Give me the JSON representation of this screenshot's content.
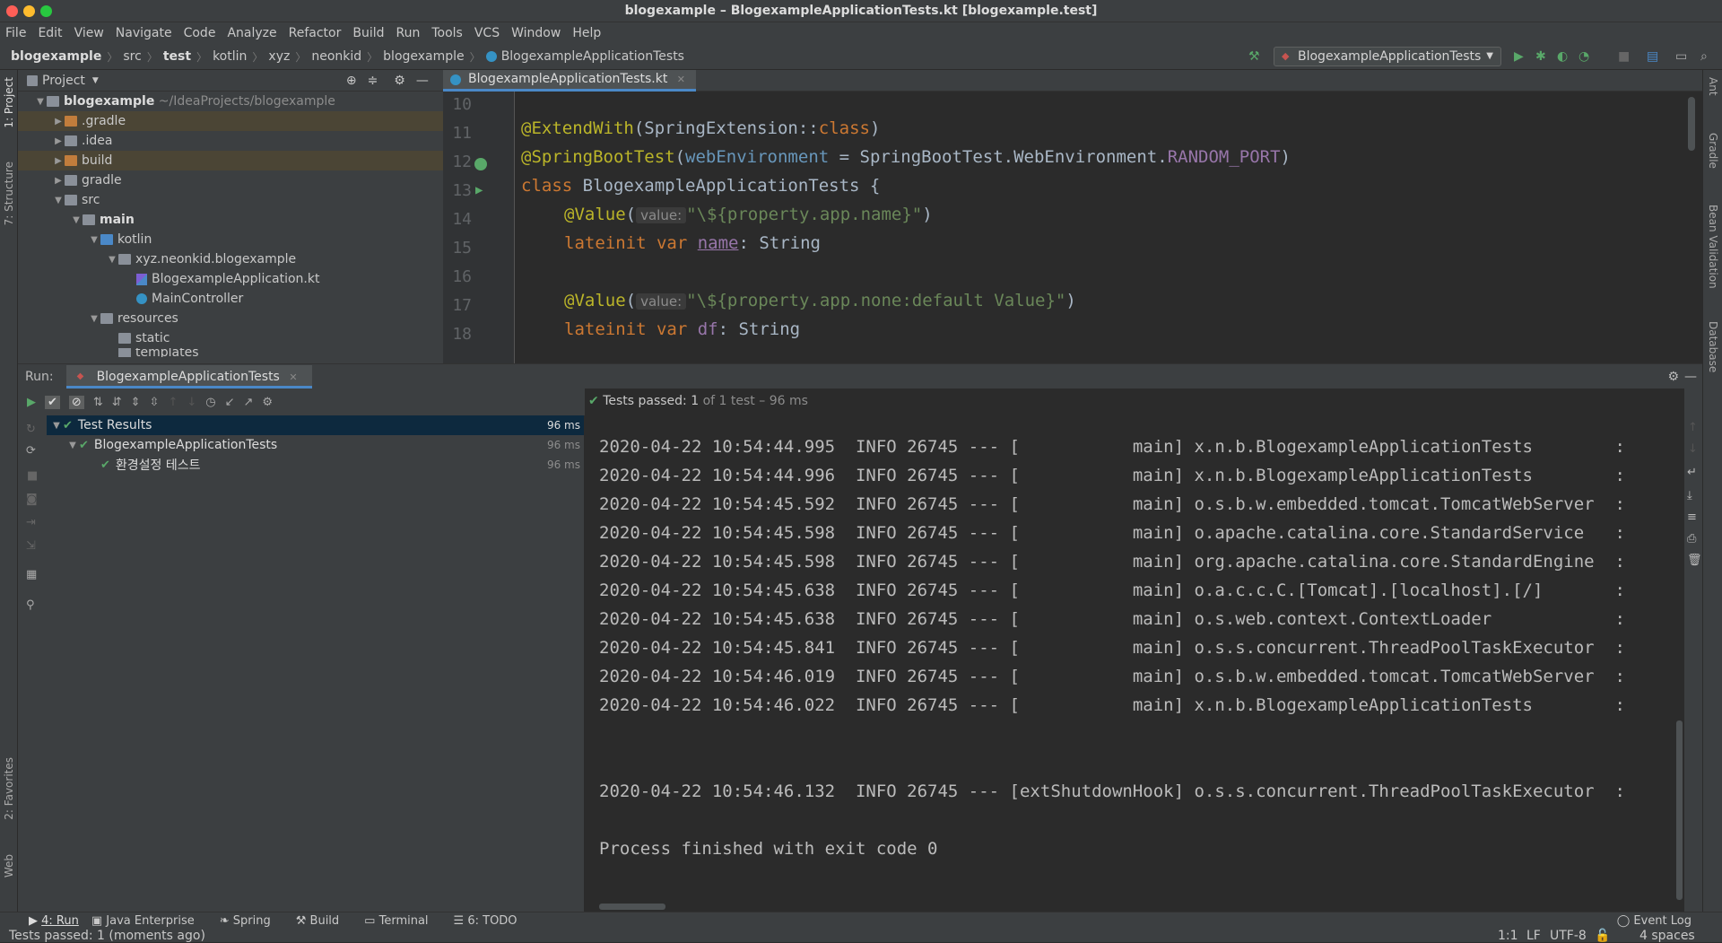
{
  "window": {
    "title": "blogexample – BlogexampleApplicationTests.kt [blogexample.test]",
    "close_color": "#ff5f57",
    "min_color": "#febc2e",
    "max_color": "#28c840"
  },
  "menu": [
    "File",
    "Edit",
    "View",
    "Navigate",
    "Code",
    "Analyze",
    "Refactor",
    "Build",
    "Run",
    "Tools",
    "VCS",
    "Window",
    "Help"
  ],
  "breadcrumb": [
    "blogexample",
    "src",
    "test",
    "kotlin",
    "xyz",
    "neonkid",
    "blogexample",
    "BlogexampleApplicationTests"
  ],
  "run_config": "BlogexampleApplicationTests",
  "project_panel": {
    "title": "Project",
    "root_name": "blogexample",
    "root_path": "~/IdeaProjects/blogexample",
    "items": [
      ".gradle",
      ".idea",
      "build",
      "gradle",
      "src",
      "main",
      "kotlin",
      "xyz.neonkid.blogexample",
      "BlogexampleApplication.kt",
      "MainController",
      "resources",
      "static",
      "templates"
    ]
  },
  "left_tabs": [
    "1: Project",
    "7: Structure",
    "2: Favorites",
    "Web"
  ],
  "right_tabs": [
    "Ant",
    "Gradle",
    "Bean Validation",
    "Database"
  ],
  "editor": {
    "tab": "BlogexampleApplicationTests.kt",
    "line_numbers": [
      "10",
      "11",
      "12",
      "13",
      "14",
      "15",
      "16",
      "17",
      "18"
    ],
    "lines": {
      "l11a": "@ExtendWith",
      "l11b": "(SpringExtension::",
      "l11c": "class",
      "l11d": ")",
      "l12a": "@SpringBootTest",
      "l12b": "(",
      "l12c": "webEnvironment",
      "l12d": " = SpringBootTest.WebEnvironment.",
      "l12e": "RANDOM_PORT",
      "l12f": ")",
      "l13a": "class ",
      "l13b": "BlogexampleApplicationTests {",
      "l14a": "@Value",
      "l14b": "(",
      "l14hint": "value:",
      "l14c": "\"\\${property.app.name}\"",
      "l14d": ")",
      "l15a": "lateinit var ",
      "l15b": "name",
      "l15c": ": String",
      "l17a": "@Value",
      "l17b": "(",
      "l17hint": "value:",
      "l17c": "\"\\${property.app.none:default Value}\"",
      "l17d": ")",
      "l18a": "lateinit var ",
      "l18b": "df",
      "l18c": ": String"
    }
  },
  "run_panel": {
    "label": "Run:",
    "tab": "BlogexampleApplicationTests"
  },
  "tests": [
    {
      "name": "Test Results",
      "time": "96 ms"
    },
    {
      "name": "BlogexampleApplicationTests",
      "time": "96 ms"
    },
    {
      "name": "환경설정 테스트",
      "time": "96 ms"
    }
  ],
  "status_text": {
    "prefix": "Tests passed:",
    "count": "1",
    "suffix": "of 1 test – 96 ms"
  },
  "console_lines": [
    "2020-04-22 10:54:44.995  INFO 26745 --- [           main] x.n.b.BlogexampleApplicationTests        :",
    "2020-04-22 10:54:44.996  INFO 26745 --- [           main] x.n.b.BlogexampleApplicationTests        :",
    "2020-04-22 10:54:45.592  INFO 26745 --- [           main] o.s.b.w.embedded.tomcat.TomcatWebServer  :",
    "2020-04-22 10:54:45.598  INFO 26745 --- [           main] o.apache.catalina.core.StandardService   :",
    "2020-04-22 10:54:45.598  INFO 26745 --- [           main] org.apache.catalina.core.StandardEngine  :",
    "2020-04-22 10:54:45.638  INFO 26745 --- [           main] o.a.c.c.C.[Tomcat].[localhost].[/]       :",
    "2020-04-22 10:54:45.638  INFO 26745 --- [           main] o.s.web.context.ContextLoader            :",
    "2020-04-22 10:54:45.841  INFO 26745 --- [           main] o.s.s.concurrent.ThreadPoolTaskExecutor  :",
    "2020-04-22 10:54:46.019  INFO 26745 --- [           main] o.s.b.w.embedded.tomcat.TomcatWebServer  :",
    "2020-04-22 10:54:46.022  INFO 26745 --- [           main] x.n.b.BlogexampleApplicationTests        :"
  ],
  "console_shutdown": "2020-04-22 10:54:46.132  INFO 26745 --- [extShutdownHook] o.s.s.concurrent.ThreadPoolTaskExecutor  :",
  "console_exit": "Process finished with exit code 0",
  "bottom_tabs": [
    "4: Run",
    "Java Enterprise",
    "Spring",
    "Build",
    "Terminal",
    "6: TODO"
  ],
  "event_log": "Event Log",
  "statusbar": {
    "message": "Tests passed: 1 (moments ago)",
    "position": "1:1",
    "line_sep": "LF",
    "encoding": "UTF-8",
    "indent": "4 spaces"
  }
}
